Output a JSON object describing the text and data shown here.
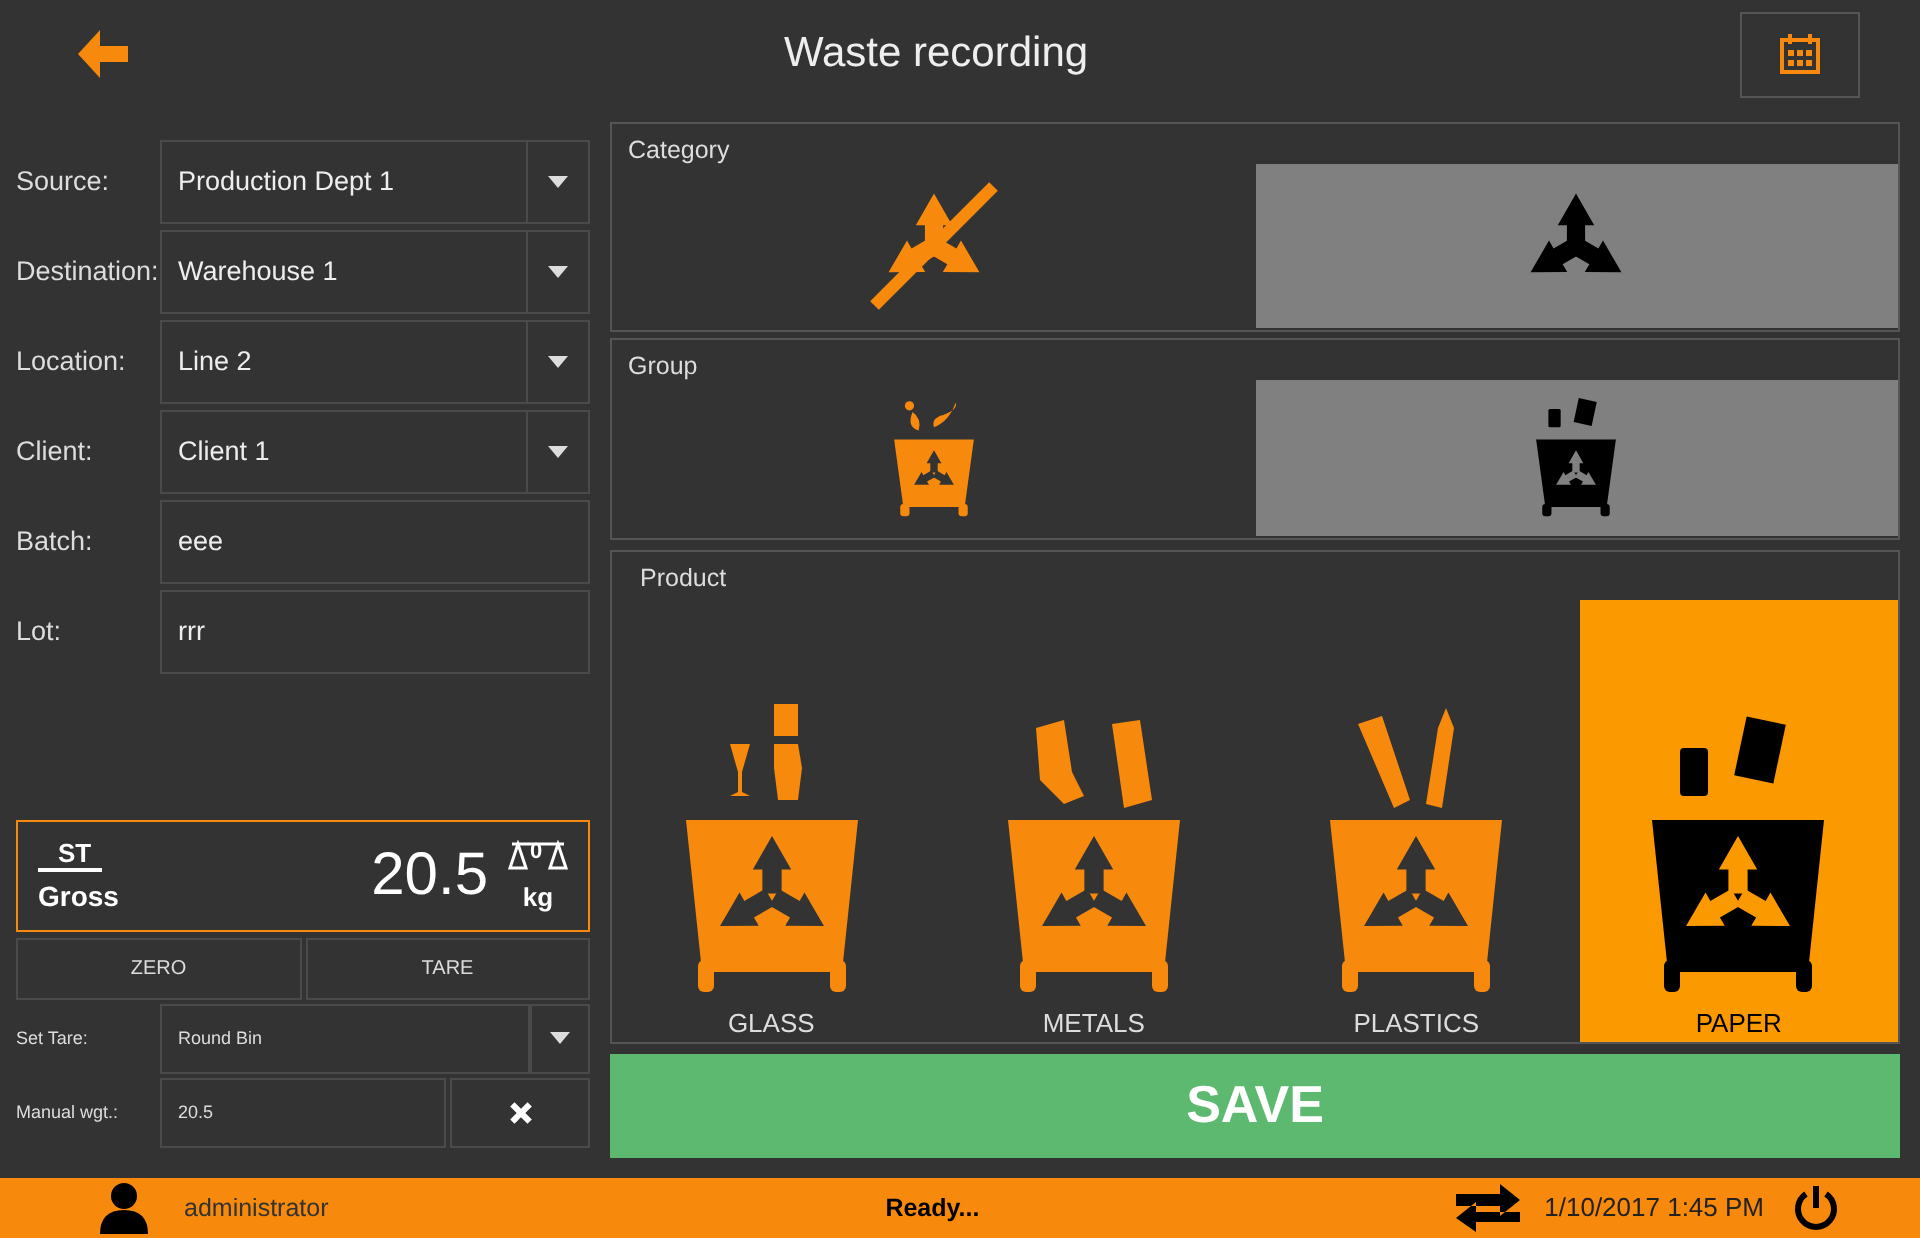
{
  "header": {
    "title": "Waste recording"
  },
  "fields": [
    {
      "label": "Source:",
      "value": "Production Dept 1",
      "kind": "dropdown"
    },
    {
      "label": "Destination:",
      "value": "Warehouse 1",
      "kind": "dropdown"
    },
    {
      "label": "Location:",
      "value": "Line 2",
      "kind": "dropdown"
    },
    {
      "label": "Client:",
      "value": "Client 1",
      "kind": "dropdown"
    },
    {
      "label": "Batch:",
      "value": "eee",
      "kind": "text"
    },
    {
      "label": "Lot:",
      "value": "rrr",
      "kind": "text"
    }
  ],
  "scale": {
    "mode": "ST",
    "type": "Gross",
    "weight": "20.5",
    "zero_mark": "0",
    "unit": "kg"
  },
  "scale_buttons": [
    "ZERO",
    "TARE"
  ],
  "tare": {
    "label": "Set Tare:",
    "value": "Round Bin"
  },
  "manual": {
    "label": "Manual wgt.:",
    "value": "20.5"
  },
  "category": {
    "title": "Category",
    "items": [
      {
        "kind": "no-recycle",
        "selected": false
      },
      {
        "kind": "recycle",
        "selected": true
      }
    ]
  },
  "group": {
    "title": "Group",
    "items": [
      {
        "kind": "mixed",
        "selected": false
      },
      {
        "kind": "paper",
        "selected": true
      }
    ]
  },
  "product": {
    "title": "Product",
    "items": [
      {
        "label": "GLASS",
        "kind": "glass",
        "selected": false
      },
      {
        "label": "METALS",
        "kind": "metals",
        "selected": false
      },
      {
        "label": "PLASTICS",
        "kind": "plastics",
        "selected": false
      },
      {
        "label": "PAPER",
        "kind": "paper",
        "selected": true
      }
    ]
  },
  "save": "SAVE",
  "status": {
    "user": "administrator",
    "message": "Ready...",
    "datetime": "1/10/2017 1:45 PM"
  }
}
